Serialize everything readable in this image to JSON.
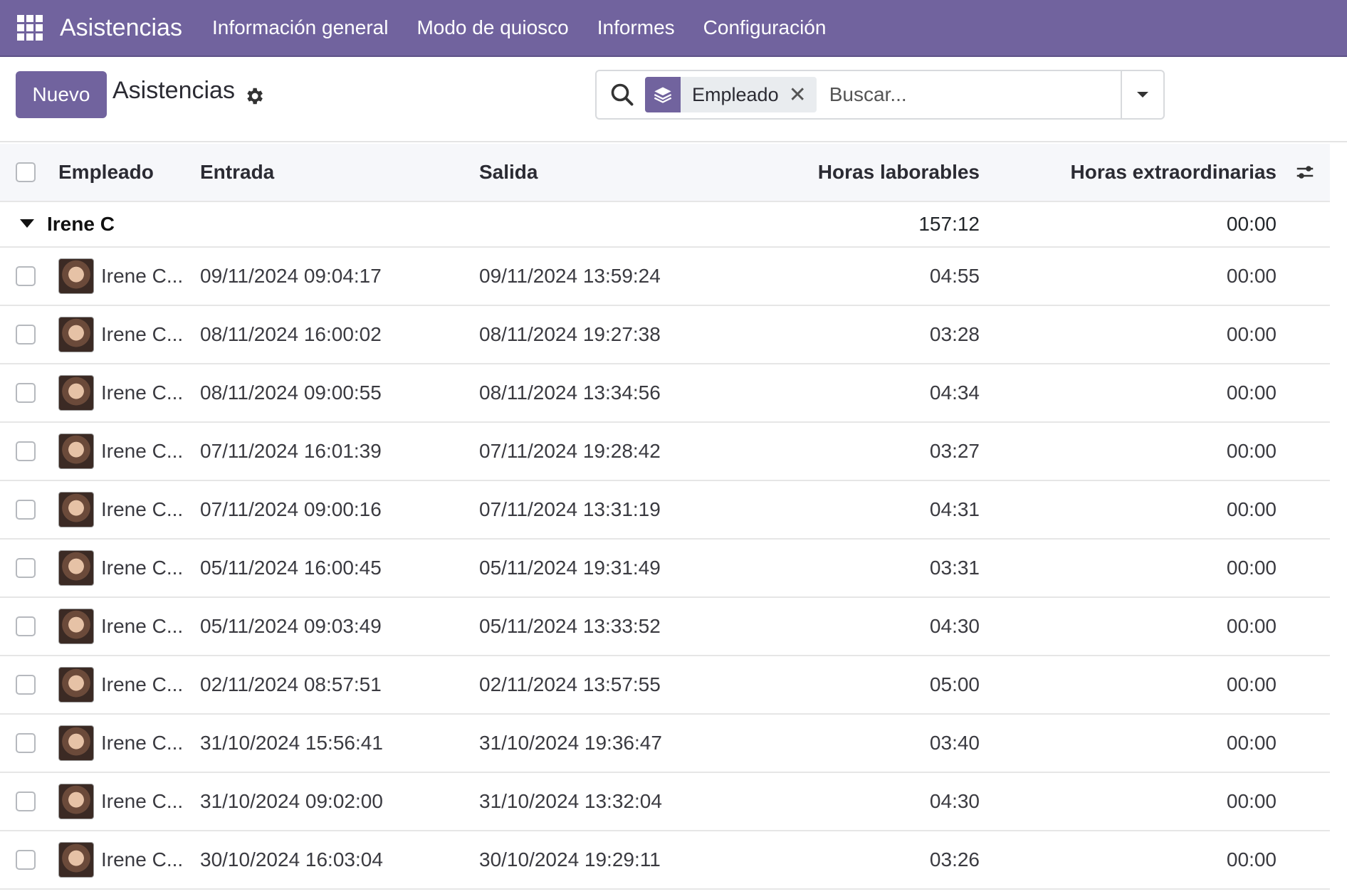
{
  "navbar": {
    "brand": "Asistencias",
    "items": [
      "Información general",
      "Modo de quiosco",
      "Informes",
      "Configuración"
    ]
  },
  "control": {
    "new_label": "Nuevo",
    "title": "Asistencias",
    "search": {
      "facet_label": "Empleado",
      "placeholder": "Buscar..."
    }
  },
  "table": {
    "headers": {
      "employee": "Empleado",
      "check_in": "Entrada",
      "check_out": "Salida",
      "worked_hours": "Horas laborables",
      "extra_hours": "Horas extraordinarias"
    },
    "group": {
      "name": "Irene C",
      "worked_hours": "157:12",
      "extra_hours": "00:00"
    },
    "rows": [
      {
        "employee": "Irene C...",
        "check_in": "09/11/2024 09:04:17",
        "check_out": "09/11/2024 13:59:24",
        "worked_hours": "04:55",
        "extra_hours": "00:00"
      },
      {
        "employee": "Irene C...",
        "check_in": "08/11/2024 16:00:02",
        "check_out": "08/11/2024 19:27:38",
        "worked_hours": "03:28",
        "extra_hours": "00:00"
      },
      {
        "employee": "Irene C...",
        "check_in": "08/11/2024 09:00:55",
        "check_out": "08/11/2024 13:34:56",
        "worked_hours": "04:34",
        "extra_hours": "00:00"
      },
      {
        "employee": "Irene C...",
        "check_in": "07/11/2024 16:01:39",
        "check_out": "07/11/2024 19:28:42",
        "worked_hours": "03:27",
        "extra_hours": "00:00"
      },
      {
        "employee": "Irene C...",
        "check_in": "07/11/2024 09:00:16",
        "check_out": "07/11/2024 13:31:19",
        "worked_hours": "04:31",
        "extra_hours": "00:00"
      },
      {
        "employee": "Irene C...",
        "check_in": "05/11/2024 16:00:45",
        "check_out": "05/11/2024 19:31:49",
        "worked_hours": "03:31",
        "extra_hours": "00:00"
      },
      {
        "employee": "Irene C...",
        "check_in": "05/11/2024 09:03:49",
        "check_out": "05/11/2024 13:33:52",
        "worked_hours": "04:30",
        "extra_hours": "00:00"
      },
      {
        "employee": "Irene C...",
        "check_in": "02/11/2024 08:57:51",
        "check_out": "02/11/2024 13:57:55",
        "worked_hours": "05:00",
        "extra_hours": "00:00"
      },
      {
        "employee": "Irene C...",
        "check_in": "31/10/2024 15:56:41",
        "check_out": "31/10/2024 19:36:47",
        "worked_hours": "03:40",
        "extra_hours": "00:00"
      },
      {
        "employee": "Irene C...",
        "check_in": "31/10/2024 09:02:00",
        "check_out": "31/10/2024 13:32:04",
        "worked_hours": "04:30",
        "extra_hours": "00:00"
      },
      {
        "employee": "Irene C...",
        "check_in": "30/10/2024 16:03:04",
        "check_out": "30/10/2024 19:29:11",
        "worked_hours": "03:26",
        "extra_hours": "00:00"
      }
    ]
  },
  "icons": {
    "apps": "apps-grid-icon",
    "gear": "gear-icon",
    "search": "search-icon",
    "facet": "layers-icon",
    "close": "close-icon",
    "dropdown": "caret-down-icon",
    "optional_columns": "sliders-icon"
  },
  "colors": {
    "brand": "#71639e"
  }
}
